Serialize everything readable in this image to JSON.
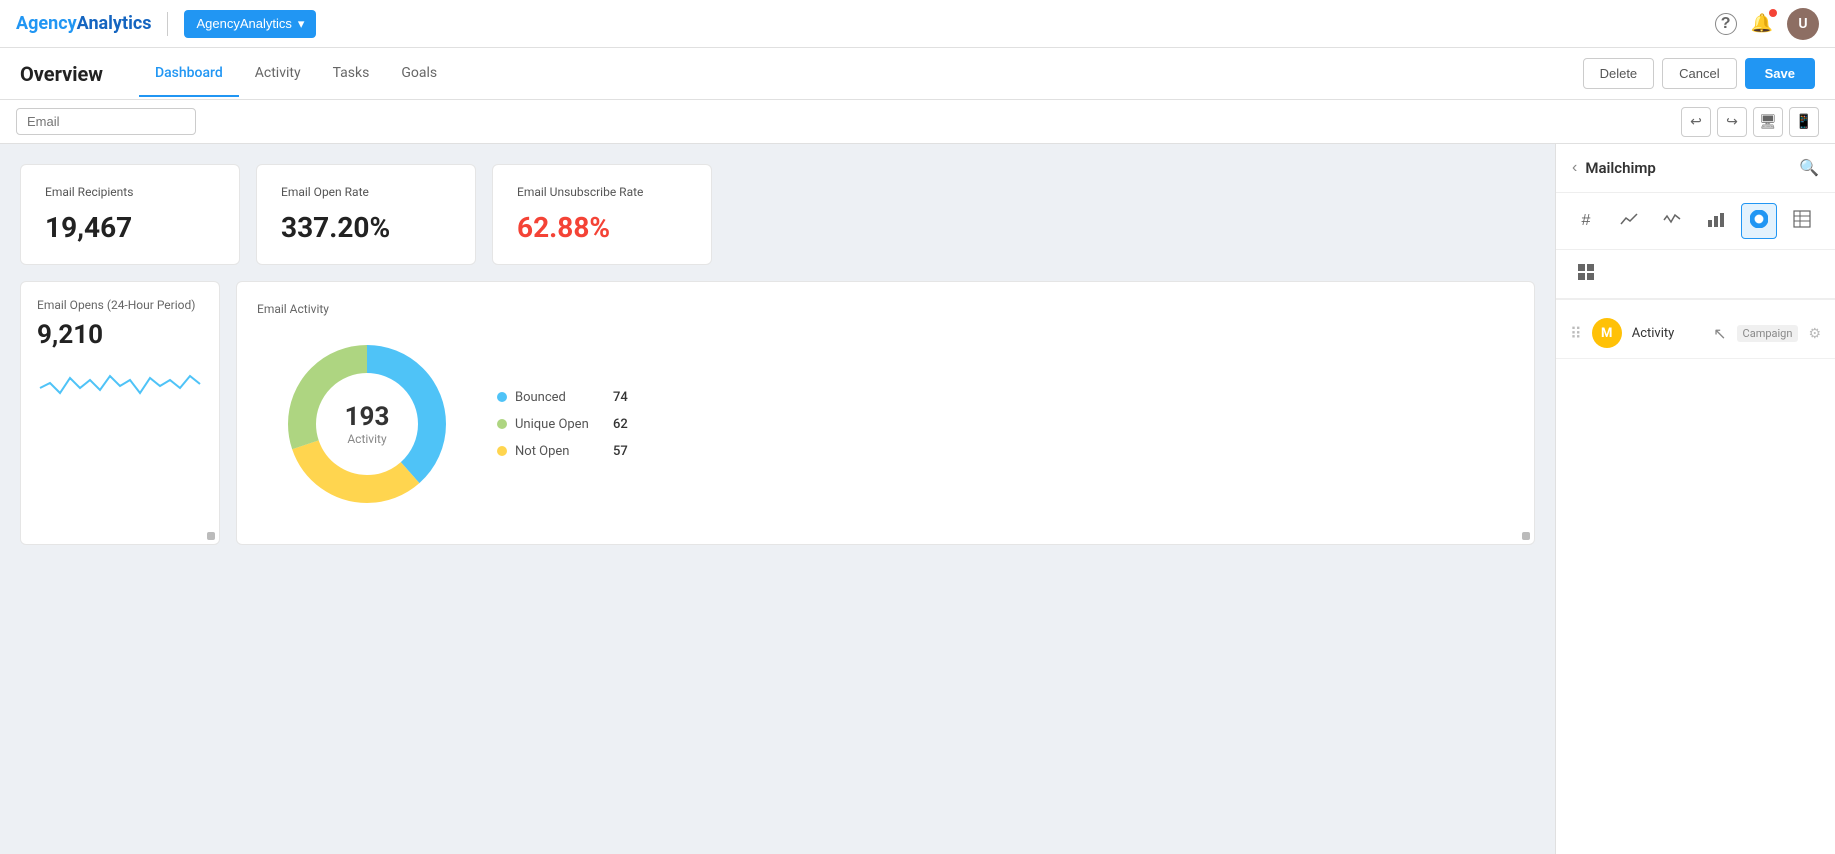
{
  "brand": {
    "agency": "Agency",
    "analytics": "Analytics",
    "dropdown_label": "AgencyAnalytics"
  },
  "navbar": {
    "help_label": "?",
    "notifications_label": "🔔",
    "avatar_initials": "U"
  },
  "subheader": {
    "overview_title": "Overview",
    "tabs": [
      {
        "label": "Dashboard",
        "active": true
      },
      {
        "label": "Activity",
        "active": false
      },
      {
        "label": "Tasks",
        "active": false
      },
      {
        "label": "Goals",
        "active": false
      }
    ],
    "btn_delete": "Delete",
    "btn_cancel": "Cancel",
    "btn_save": "Save"
  },
  "filter_bar": {
    "email_placeholder": "Email"
  },
  "stats": [
    {
      "label": "Email Recipients",
      "value": "19,467",
      "style": "normal"
    },
    {
      "label": "Email Open Rate",
      "value": "337.20%",
      "style": "normal"
    },
    {
      "label": "Email Unsubscribe Rate",
      "value": "62.88%",
      "style": "unsubscribe"
    }
  ],
  "chart_small": {
    "title": "Email Opens (24-Hour Period)",
    "value": "9,210"
  },
  "chart_large": {
    "title": "Email Activity",
    "donut": {
      "center_value": "193",
      "center_label": "Activity",
      "segments": [
        {
          "label": "Bounced",
          "value": 74,
          "color": "#4FC3F7",
          "percent": 0.384
        },
        {
          "label": "Unique Open",
          "value": 62,
          "color": "#AED581",
          "percent": 0.321
        },
        {
          "label": "Not Open",
          "value": 57,
          "color": "#FFD54F",
          "percent": 0.295
        }
      ]
    }
  },
  "right_panel": {
    "title": "Mailchimp",
    "back_icon": "‹",
    "search_icon": "🔍",
    "widget_types": [
      {
        "icon": "#",
        "active": false,
        "name": "metric"
      },
      {
        "icon": "📈",
        "active": false,
        "name": "line-chart"
      },
      {
        "icon": "〰",
        "active": false,
        "name": "sparkline"
      },
      {
        "icon": "📊",
        "active": false,
        "name": "bar-chart"
      },
      {
        "icon": "◉",
        "active": true,
        "name": "donut-chart"
      },
      {
        "icon": "≡",
        "active": false,
        "name": "list"
      }
    ],
    "widget_types_row2": [
      {
        "icon": "▦",
        "name": "table"
      }
    ],
    "widgets": [
      {
        "drag": "⠿",
        "icon_bg": "#FFC107",
        "icon_text": "M",
        "name": "Activity",
        "tag": "Campaign",
        "settings_icon": "⚙"
      }
    ]
  }
}
